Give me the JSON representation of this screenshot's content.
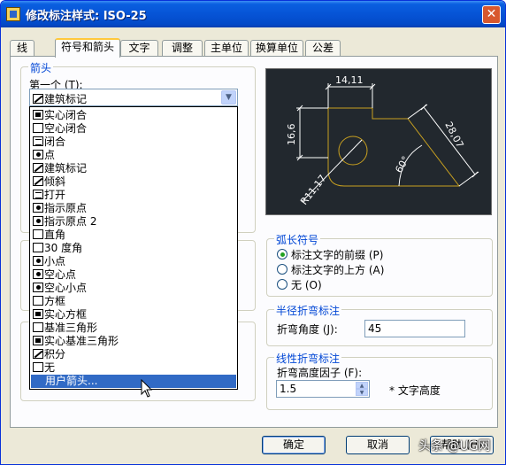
{
  "window": {
    "title": "修改标注样式: ISO-25",
    "close_glyph": "✕"
  },
  "tabs": [
    {
      "label": "线"
    },
    {
      "label": "符号和箭头"
    },
    {
      "label": "文字"
    },
    {
      "label": "调整"
    },
    {
      "label": "主单位"
    },
    {
      "label": "换算单位"
    },
    {
      "label": "公差"
    }
  ],
  "arrows_group": {
    "title": "箭头",
    "first_label": "第一个 (T):",
    "first_value": "建筑标记"
  },
  "arrow_dropdown": {
    "items": [
      {
        "label": "实心闭合",
        "icon": "filled"
      },
      {
        "label": "空心闭合",
        "icon": "plain"
      },
      {
        "label": "闭合",
        "icon": "lines"
      },
      {
        "label": "点",
        "icon": "dot"
      },
      {
        "label": "建筑标记",
        "icon": "slash"
      },
      {
        "label": "倾斜",
        "icon": "slash"
      },
      {
        "label": "打开",
        "icon": "lines"
      },
      {
        "label": "指示原点",
        "icon": "dot"
      },
      {
        "label": "指示原点 2",
        "icon": "dot"
      },
      {
        "label": "直角",
        "icon": "plain"
      },
      {
        "label": "30 度角",
        "icon": "plain"
      },
      {
        "label": "小点",
        "icon": "dot"
      },
      {
        "label": "空心点",
        "icon": "dot"
      },
      {
        "label": "空心小点",
        "icon": "dot"
      },
      {
        "label": "方框",
        "icon": "plain"
      },
      {
        "label": "实心方框",
        "icon": "filled"
      },
      {
        "label": "基准三角形",
        "icon": "plain"
      },
      {
        "label": "实心基准三角形",
        "icon": "filled"
      },
      {
        "label": "积分",
        "icon": "slash"
      },
      {
        "label": "无",
        "icon": "plain"
      },
      {
        "label": "用户箭头...",
        "icon": "none"
      }
    ],
    "selected_index": 20
  },
  "preview": {
    "dim_top": "14,11",
    "dim_left": "16,6",
    "dim_right": "28,07",
    "dim_radius": "R11,17",
    "dim_angle": "60°",
    "line_color": "#c8a020",
    "text_color": "#ffffff",
    "bg_color": "#22282e"
  },
  "arc_length": {
    "title": "弧长符号",
    "options": [
      {
        "label": "标注文字的前缀 (P)",
        "checked": true
      },
      {
        "label": "标注文字的上方 (A)",
        "checked": false
      },
      {
        "label": "无 (O)",
        "checked": false
      }
    ]
  },
  "radius_jog": {
    "title": "半径折弯标注",
    "angle_label": "折弯角度 (J):",
    "angle_value": "45"
  },
  "linear_jog": {
    "title": "线性折弯标注",
    "factor_label": "折弯高度因子 (F):",
    "factor_value": "1.5",
    "factor_suffix": "* 文字高度"
  },
  "buttons": {
    "ok": "确定",
    "cancel": "取消",
    "help": "帮助 (H)"
  },
  "watermark": "头条 @UG网"
}
